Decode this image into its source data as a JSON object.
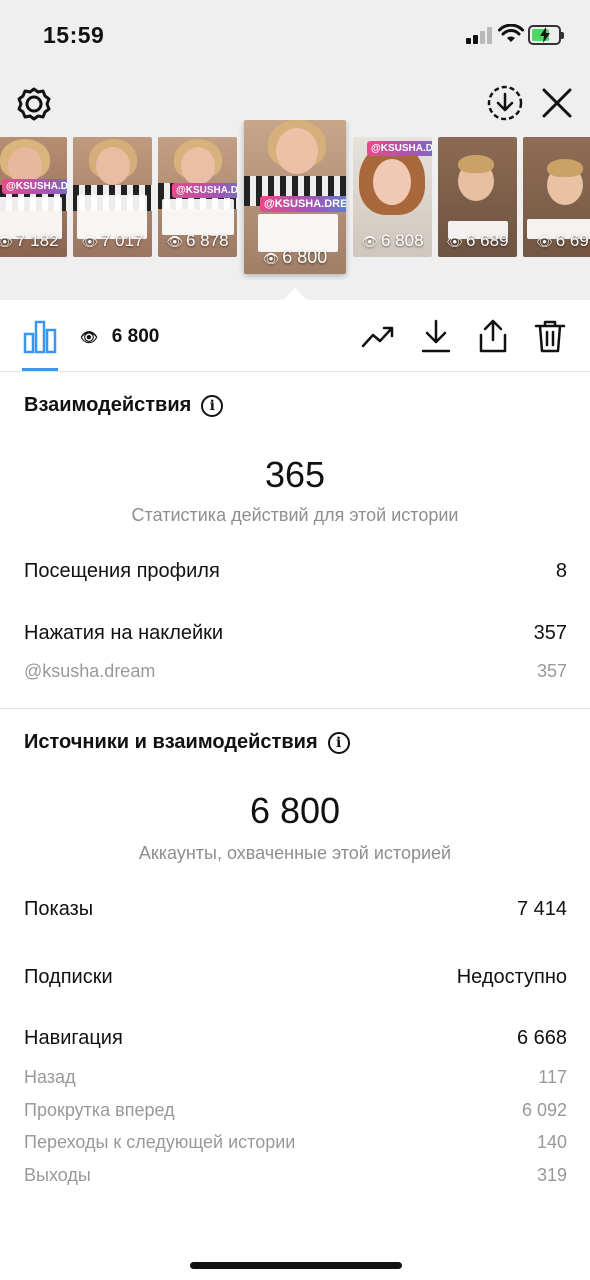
{
  "status_bar": {
    "time": "15:59"
  },
  "stories": [
    {
      "views": "7 182",
      "handle": "@KSUSHA.DREAM"
    },
    {
      "views": "7 017",
      "handle": ""
    },
    {
      "views": "6 878",
      "handle": "@KSUSHA.DREAM"
    },
    {
      "views": "6 800",
      "handle": "@KSUSHA.DREAM",
      "selected": true
    },
    {
      "views": "6 808",
      "handle": "@KSUSHA.DREAM"
    },
    {
      "views": "6 689",
      "handle": ""
    },
    {
      "views": "6 69",
      "handle": ""
    }
  ],
  "toolbar": {
    "views": "6 800"
  },
  "interactions": {
    "title": "Взаимодействия",
    "total": "365",
    "caption": "Статистика действий для этой истории",
    "profile_visits": {
      "label": "Посещения профиля",
      "value": "8"
    },
    "sticker_taps": {
      "label": "Нажатия на наклейки",
      "value": "357"
    },
    "mention": {
      "label": "@ksusha.dream",
      "value": "357"
    }
  },
  "discovery": {
    "title": "Источники и взаимодействия",
    "reach": "6 800",
    "caption": "Аккаунты, охваченные этой историей",
    "impressions": {
      "label": "Показы",
      "value": "7 414"
    },
    "follows": {
      "label": "Подписки",
      "value": "Недоступно"
    },
    "navigation": {
      "label": "Навигация",
      "value": "6 668"
    },
    "back": {
      "label": "Назад",
      "value": "117"
    },
    "forward": {
      "label": "Прокрутка вперед",
      "value": "6 092"
    },
    "next_story": {
      "label": "Переходы к следующей истории",
      "value": "140"
    },
    "exits": {
      "label": "Выходы",
      "value": "319"
    }
  },
  "colors": {
    "accent": "#3897f0",
    "muted": "#8e8e8e",
    "panel": "#efefef"
  }
}
